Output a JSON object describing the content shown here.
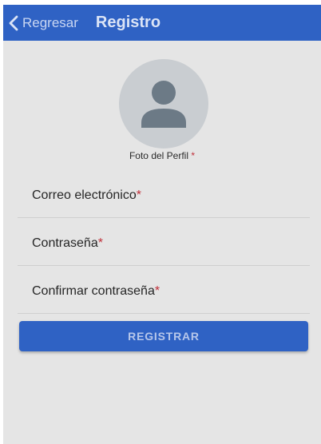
{
  "header": {
    "back_label": "Regresar",
    "title": "Registro",
    "back_icon": "chevron-left-icon"
  },
  "profile": {
    "avatar_icon": "person-icon",
    "photo_label": "Foto del Perfil",
    "required_mark": "*"
  },
  "form": {
    "fields": [
      {
        "label": "Correo electrónico",
        "required_mark": "*"
      },
      {
        "label": "Contraseña",
        "required_mark": "*"
      },
      {
        "label": "Confirmar contraseña",
        "required_mark": "*"
      }
    ],
    "submit_label": "REGISTRAR"
  },
  "colors": {
    "accent": "#2f62c4",
    "background": "#e5e5e5",
    "required": "#c0303a"
  }
}
